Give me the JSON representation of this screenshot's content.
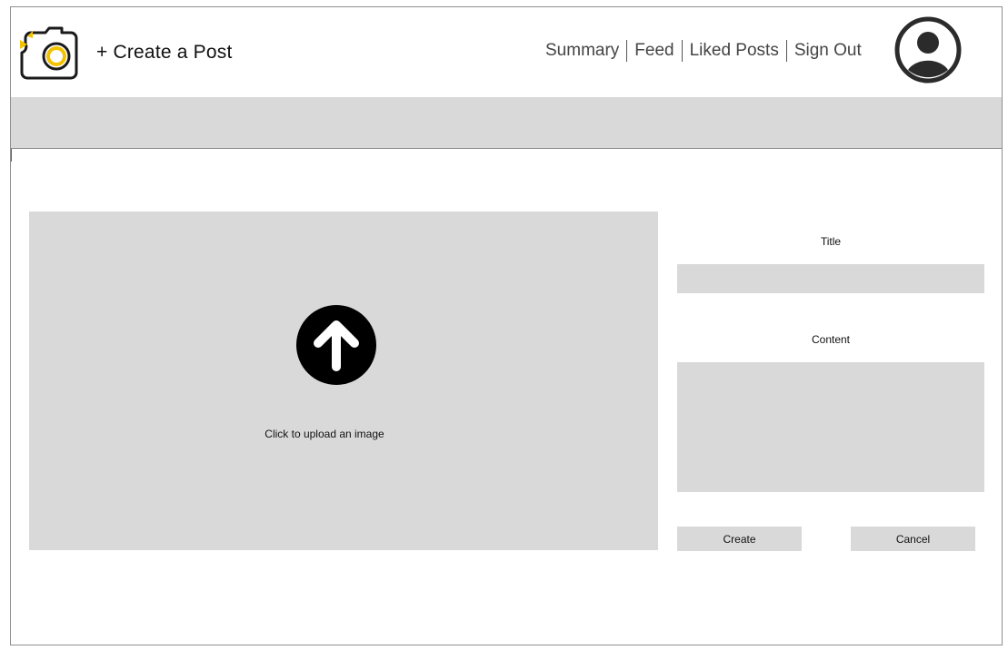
{
  "header": {
    "brand_title": "+ Create a Post",
    "logo_icon": "camera-icon",
    "nav": [
      {
        "label": "Summary"
      },
      {
        "label": "Feed"
      },
      {
        "label": "Liked Posts"
      },
      {
        "label": "Sign Out"
      }
    ],
    "avatar_icon": "user-avatar-icon"
  },
  "upload": {
    "icon": "upload-arrow-icon",
    "label": "Click to upload an image"
  },
  "form": {
    "title_label": "Title",
    "title_value": "",
    "content_label": "Content",
    "content_value": "",
    "create_label": "Create",
    "cancel_label": "Cancel"
  },
  "colors": {
    "panel_gray": "#d9d9d9",
    "accent_yellow": "#f2c200",
    "icon_dark": "#1a1a1a"
  }
}
